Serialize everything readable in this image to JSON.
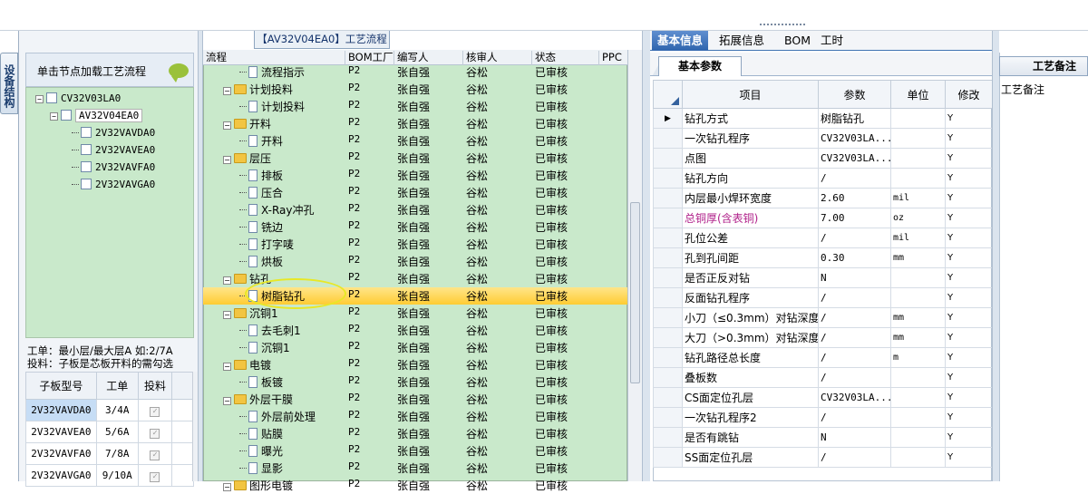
{
  "left": {
    "tab_label": "设备结构",
    "header_text": "单击节点加载工艺流程",
    "tree": [
      {
        "label": "CV32V03LA0",
        "level": 0
      },
      {
        "label": "AV32V04EA0",
        "level": 1
      },
      {
        "label": "2V32VAVDA0",
        "level": 2
      },
      {
        "label": "2V32VAVEA0",
        "level": 2
      },
      {
        "label": "2V32VAVFA0",
        "level": 2
      },
      {
        "label": "2V32VAVGA0",
        "level": 2
      }
    ],
    "note_line1": "工单：最小层/最大层A 如:2/7A",
    "note_line2": "投料：子板是芯板开料的需勾选",
    "table_headers": [
      "子板型号",
      "工单",
      "投料"
    ],
    "table_rows": [
      {
        "model": "2V32VAVDA0",
        "order": "3/4A",
        "feed": "✓"
      },
      {
        "model": "2V32VAVEA0",
        "order": "5/6A",
        "feed": "✓"
      },
      {
        "model": "2V32VAVFA0",
        "order": "7/8A",
        "feed": "✓"
      },
      {
        "model": "2V32VAVGA0",
        "order": "9/10A",
        "feed": "✓"
      }
    ]
  },
  "center": {
    "title": "【AV32V04EA0】工艺流程",
    "headers": [
      "流程",
      "BOM工厂",
      "编写人",
      "核审人",
      "状态",
      "PPC"
    ],
    "rows": [
      {
        "name": "流程指示",
        "kind": "leaf",
        "bom": "P2",
        "writer": "张自强",
        "reviewer": "谷松",
        "status": "已审核"
      },
      {
        "name": "计划投料",
        "kind": "group",
        "bom": "P2",
        "writer": "张自强",
        "reviewer": "谷松",
        "status": "已审核"
      },
      {
        "name": "计划投料",
        "kind": "leaf",
        "bom": "P2",
        "writer": "张自强",
        "reviewer": "谷松",
        "status": "已审核"
      },
      {
        "name": "开料",
        "kind": "group",
        "bom": "P2",
        "writer": "张自强",
        "reviewer": "谷松",
        "status": "已审核"
      },
      {
        "name": "开料",
        "kind": "leaf",
        "bom": "P2",
        "writer": "张自强",
        "reviewer": "谷松",
        "status": "已审核"
      },
      {
        "name": "层压",
        "kind": "group",
        "bom": "P2",
        "writer": "张自强",
        "reviewer": "谷松",
        "status": "已审核"
      },
      {
        "name": "排板",
        "kind": "leaf",
        "bom": "P2",
        "writer": "张自强",
        "reviewer": "谷松",
        "status": "已审核"
      },
      {
        "name": "压合",
        "kind": "leaf",
        "bom": "P2",
        "writer": "张自强",
        "reviewer": "谷松",
        "status": "已审核"
      },
      {
        "name": "X-Ray冲孔",
        "kind": "leaf",
        "bom": "P2",
        "writer": "张自强",
        "reviewer": "谷松",
        "status": "已审核"
      },
      {
        "name": "铣边",
        "kind": "leaf",
        "bom": "P2",
        "writer": "张自强",
        "reviewer": "谷松",
        "status": "已审核"
      },
      {
        "name": "打字唛",
        "kind": "leaf",
        "bom": "P2",
        "writer": "张自强",
        "reviewer": "谷松",
        "status": "已审核"
      },
      {
        "name": "烘板",
        "kind": "leaf",
        "bom": "P2",
        "writer": "张自强",
        "reviewer": "谷松",
        "status": "已审核"
      },
      {
        "name": "钻孔",
        "kind": "group",
        "bom": "P2",
        "writer": "张自强",
        "reviewer": "谷松",
        "status": "已审核"
      },
      {
        "name": "树脂钻孔",
        "kind": "leaf",
        "bom": "P2",
        "writer": "张自强",
        "reviewer": "谷松",
        "status": "已审核",
        "selected": true
      },
      {
        "name": "沉铜1",
        "kind": "group",
        "bom": "P2",
        "writer": "张自强",
        "reviewer": "谷松",
        "status": "已审核"
      },
      {
        "name": "去毛刺1",
        "kind": "leaf",
        "bom": "P2",
        "writer": "张自强",
        "reviewer": "谷松",
        "status": "已审核"
      },
      {
        "name": "沉铜1",
        "kind": "leaf",
        "bom": "P2",
        "writer": "张自强",
        "reviewer": "谷松",
        "status": "已审核"
      },
      {
        "name": "电镀",
        "kind": "group",
        "bom": "P2",
        "writer": "张自强",
        "reviewer": "谷松",
        "status": "已审核"
      },
      {
        "name": "板镀",
        "kind": "leaf",
        "bom": "P2",
        "writer": "张自强",
        "reviewer": "谷松",
        "status": "已审核"
      },
      {
        "name": "外层干膜",
        "kind": "group",
        "bom": "P2",
        "writer": "张自强",
        "reviewer": "谷松",
        "status": "已审核"
      },
      {
        "name": "外层前处理",
        "kind": "leaf",
        "bom": "P2",
        "writer": "张自强",
        "reviewer": "谷松",
        "status": "已审核"
      },
      {
        "name": "贴膜",
        "kind": "leaf",
        "bom": "P2",
        "writer": "张自强",
        "reviewer": "谷松",
        "status": "已审核"
      },
      {
        "name": "曝光",
        "kind": "leaf",
        "bom": "P2",
        "writer": "张自强",
        "reviewer": "谷松",
        "status": "已审核"
      },
      {
        "name": "显影",
        "kind": "leaf",
        "bom": "P2",
        "writer": "张自强",
        "reviewer": "谷松",
        "status": "已审核"
      },
      {
        "name": "图形电镀",
        "kind": "group",
        "bom": "P2",
        "writer": "张自强",
        "reviewer": "谷松",
        "status": "已审核"
      }
    ]
  },
  "right": {
    "tabs": [
      "基本信息",
      "拓展信息",
      "BOM",
      "工时"
    ],
    "subtab": "基本参数",
    "headers": [
      "项目",
      "参数",
      "单位",
      "修改"
    ],
    "rows": [
      {
        "name": "钻孔方式",
        "value": "树脂钻孔",
        "unit": "",
        "mod": "Y",
        "current": true
      },
      {
        "name": "一次钻孔程序",
        "value": "CV32V03LA...",
        "unit": "",
        "mod": "Y"
      },
      {
        "name": "点图",
        "value": "CV32V03LA...",
        "unit": "",
        "mod": "Y"
      },
      {
        "name": "钻孔方向",
        "value": "/",
        "unit": "",
        "mod": "Y"
      },
      {
        "name": "内层最小焊环宽度",
        "value": "2.60",
        "unit": "mil",
        "mod": "Y"
      },
      {
        "name": "总铜厚(含表铜)",
        "value": "7.00",
        "unit": "oz",
        "mod": "Y",
        "highlight": true
      },
      {
        "name": "孔位公差",
        "value": "/",
        "unit": "mil",
        "mod": "Y"
      },
      {
        "name": "孔到孔间距",
        "value": "0.30",
        "unit": "mm",
        "mod": "Y"
      },
      {
        "name": "是否正反对钻",
        "value": "N",
        "unit": "",
        "mod": "Y"
      },
      {
        "name": "反面钻孔程序",
        "value": "/",
        "unit": "",
        "mod": "Y"
      },
      {
        "name": "小刀（≤0.3mm）对钻深度",
        "value": "/",
        "unit": "mm",
        "mod": "Y"
      },
      {
        "name": "大刀（>0.3mm）对钻深度",
        "value": "/",
        "unit": "mm",
        "mod": "Y"
      },
      {
        "name": "钻孔路径总长度",
        "value": "/",
        "unit": "m",
        "mod": "Y"
      },
      {
        "name": "叠板数",
        "value": "/",
        "unit": "",
        "mod": "Y"
      },
      {
        "name": "CS面定位孔层",
        "value": "CV32V03LA...",
        "unit": "",
        "mod": "Y"
      },
      {
        "name": "一次钻孔程序2",
        "value": "/",
        "unit": "",
        "mod": "Y"
      },
      {
        "name": "是否有跳钻",
        "value": "N",
        "unit": "",
        "mod": "Y"
      },
      {
        "name": "SS面定位孔层",
        "value": "/",
        "unit": "",
        "mod": "Y"
      }
    ]
  },
  "far_right": {
    "header": "工艺备注",
    "note_label": "工艺备注"
  },
  "colors": {
    "tree_bg": "#c9e9cb",
    "selected_row": "#ffcc33",
    "tab_active": "#2f64ad",
    "highlight_text": "#b0208a"
  }
}
